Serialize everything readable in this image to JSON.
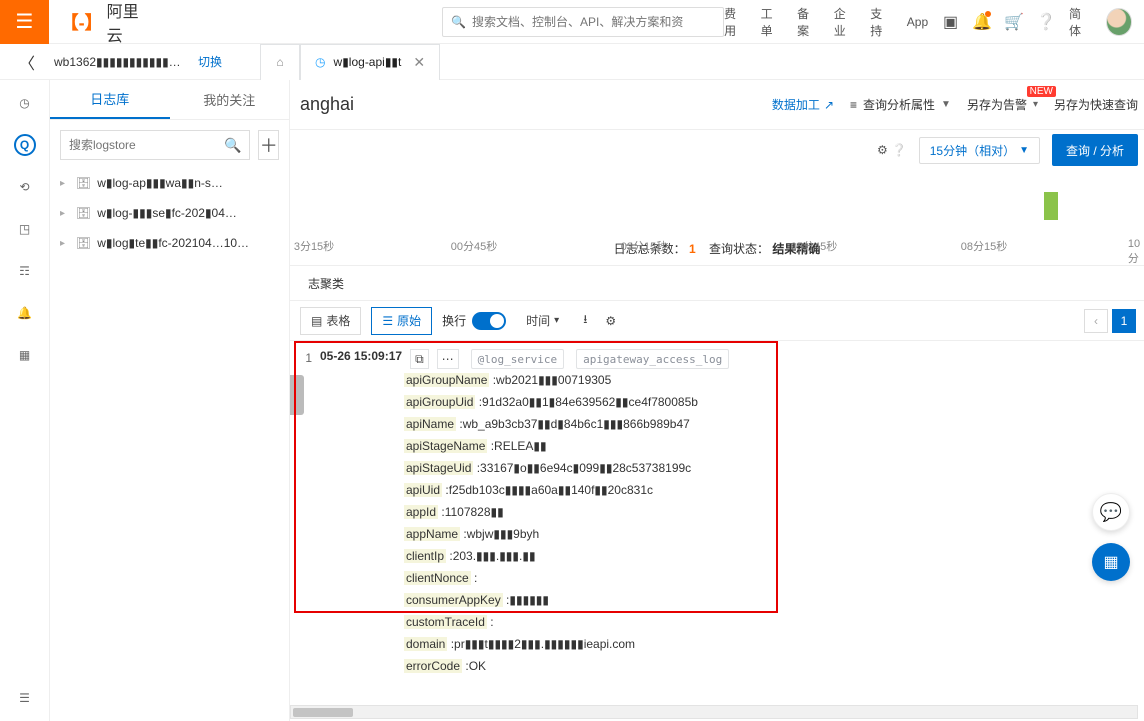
{
  "header": {
    "brand_mark": "【-】",
    "brand_text": "阿里云",
    "search_placeholder": "搜索文档、控制台、API、解决方案和资",
    "links": [
      "费用",
      "工单",
      "备案",
      "企业",
      "支持",
      "App"
    ],
    "lang_label": "简体"
  },
  "breadcrumb": {
    "project": "wb1362▮▮▮▮▮▮▮▮▮▮▮…",
    "switch_label": "切换",
    "tab_label": "w▮log-api▮▮t"
  },
  "sidebar": {
    "tabs": {
      "logstore": "日志库",
      "follow": "我的关注"
    },
    "search_placeholder": "搜索logstore",
    "items": [
      "w▮log-ap▮▮▮wa▮▮n-s…",
      "w▮log-▮▮▮se▮fc-202▮04…",
      "w▮log▮te▮▮fc-202104…10…"
    ]
  },
  "content": {
    "region_title": "anghai",
    "data_process": "数据加工",
    "analysis_attr": "查询分析属性",
    "save_alert": "另存为告警",
    "new_badge": "NEW",
    "save_fastquery": "另存为快速查询",
    "time_range": "15分钟（相对）",
    "query_btn": "查询 / 分析",
    "ticks": [
      "3分15秒",
      "00分45秒",
      "03分15秒",
      "05分45秒",
      "08分15秒",
      "10分"
    ],
    "total_label": "日志总条数：",
    "total_value": "1",
    "status_label": "查询状态：",
    "status_value": "结果精确",
    "tabsec": "志聚类",
    "toggles": {
      "table": "表格",
      "raw": "原始",
      "wrap": "换行",
      "time": "时间"
    },
    "log": {
      "index": "1",
      "timestamp": "05-26 15:09:17",
      "service_chip": "@log_service",
      "source_chip": "apigateway_access_log",
      "fields": [
        {
          "k": "apiGroupName",
          "v": ":wb2021▮▮▮00719305"
        },
        {
          "k": "apiGroupUid",
          "v": ":91d32a0▮▮1▮84e639562▮▮ce4f780085b"
        },
        {
          "k": "apiName",
          "v": ":wb_a9b3cb37▮▮d▮84b6c1▮▮▮866b989b47"
        },
        {
          "k": "apiStageName",
          "v": ":RELEA▮▮"
        },
        {
          "k": "apiStageUid",
          "v": ":33167▮o▮▮6e94c▮099▮▮28c53738199c"
        },
        {
          "k": "apiUid",
          "v": ":f25db103c▮▮▮▮a60a▮▮140f▮▮20c831c"
        },
        {
          "k": "appId",
          "v": ":1107828▮▮"
        },
        {
          "k": "appName",
          "v": ":wbjw▮▮▮9byh"
        },
        {
          "k": "clientIp",
          "v": ":203.▮▮▮.▮▮▮.▮▮"
        },
        {
          "k": "clientNonce",
          "v": ":"
        },
        {
          "k": "consumerAppKey",
          "v": ":▮▮▮▮▮▮"
        },
        {
          "k": "customTraceId",
          "v": ":"
        },
        {
          "k": "domain",
          "v": ":pr▮▮▮t▮▮▮▮2▮▮▮.▮▮▮▮▮▮ieapi.com"
        },
        {
          "k": "errorCode",
          "v": ":OK"
        }
      ]
    }
  }
}
